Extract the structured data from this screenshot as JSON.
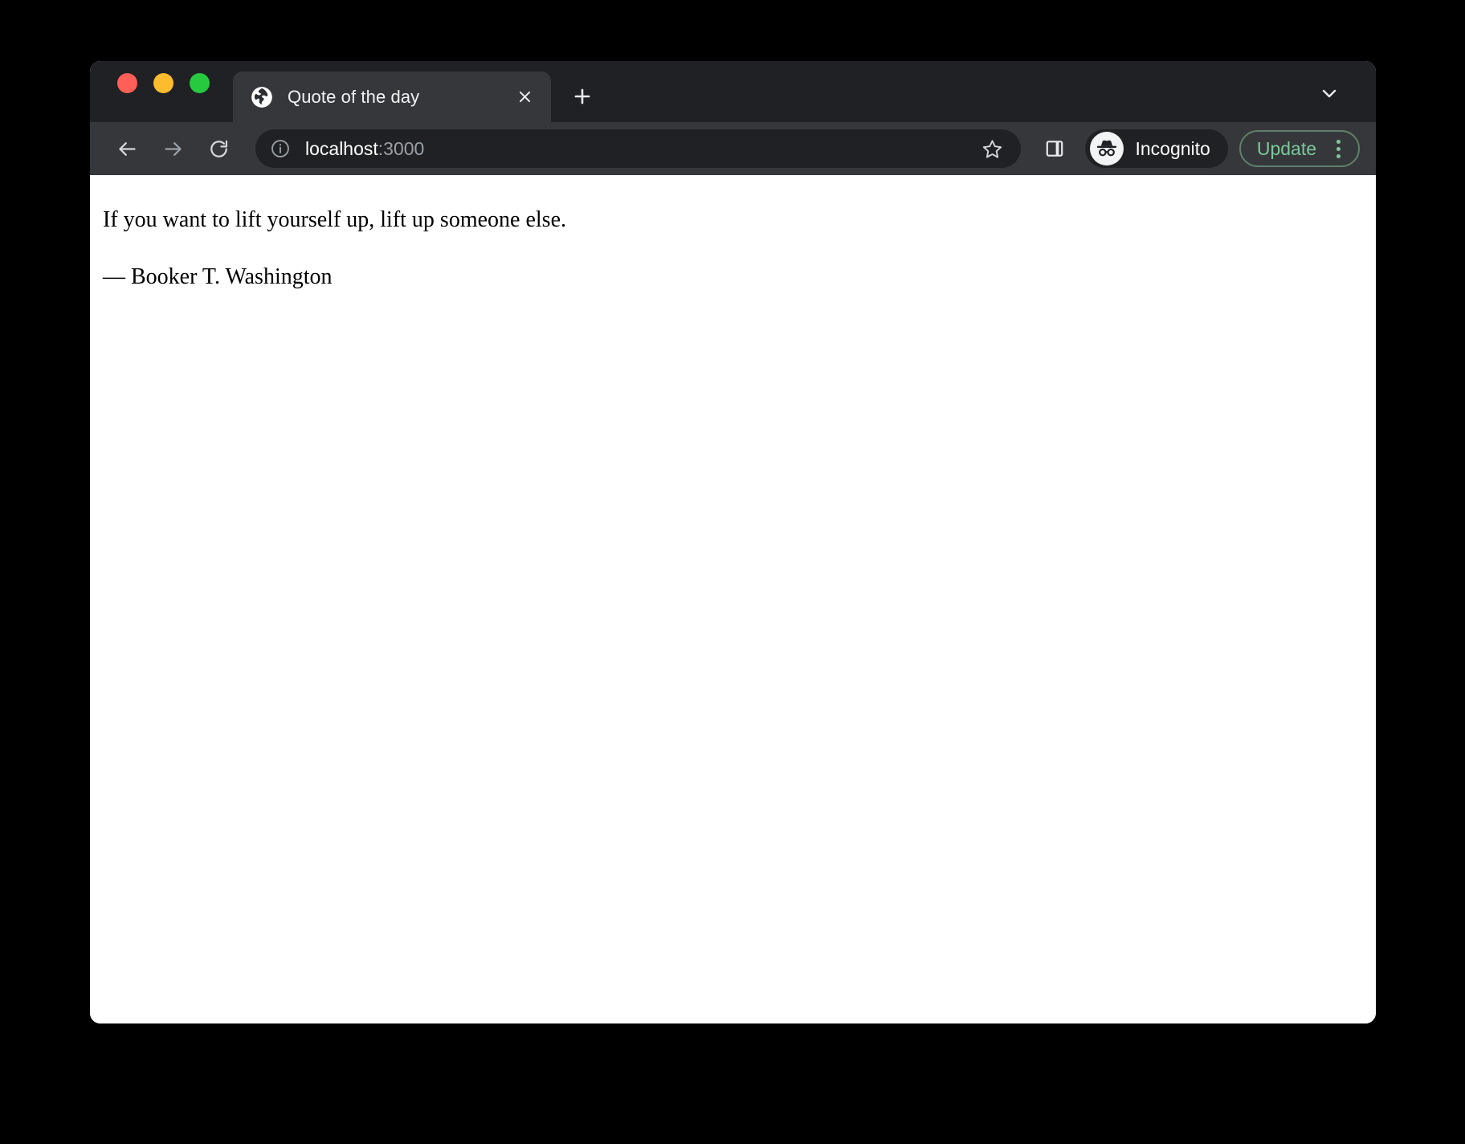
{
  "window": {
    "traffic_lights": [
      {
        "name": "close",
        "color": "#ff5f56"
      },
      {
        "name": "minimize",
        "color": "#fdbc2d"
      },
      {
        "name": "maximize",
        "color": "#27c93f"
      }
    ]
  },
  "tab_strip": {
    "tab": {
      "favicon": "globe-icon",
      "title": "Quote of the day",
      "close_icon": "close-icon"
    },
    "new_tab_icon": "plus-icon",
    "tab_search_icon": "chevron-down-icon"
  },
  "toolbar": {
    "back_icon": "arrow-left-icon",
    "forward_icon": "arrow-right-icon",
    "reload_icon": "reload-icon",
    "omnibox": {
      "info_icon": "info-circle-icon",
      "host": "localhost",
      "port": ":3000",
      "full_url": "localhost:3000"
    },
    "bookmark_icon": "star-icon",
    "side_panel_icon": "side-panel-icon",
    "incognito": {
      "avatar_icon": "incognito-icon",
      "label": "Incognito"
    },
    "update": {
      "label": "Update",
      "menu_icon": "kebab-menu-icon",
      "accent_color": "#7dc99a",
      "border_color": "#5f7f69"
    }
  },
  "page": {
    "quote": "If you want to lift yourself up, lift up someone else.",
    "attribution": "— Booker T. Washington"
  }
}
